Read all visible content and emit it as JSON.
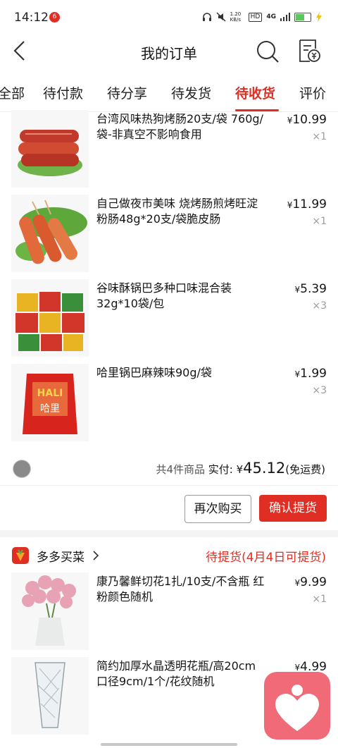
{
  "status_bar": {
    "time": "14:12",
    "notif": "6",
    "speed": "1.20 KB/s",
    "hd": "HD",
    "network": "4G"
  },
  "nav": {
    "title": "我的订单"
  },
  "tabs": [
    {
      "label": "全部"
    },
    {
      "label": "待付款"
    },
    {
      "label": "待分享"
    },
    {
      "label": "待发货"
    },
    {
      "label": "待收货",
      "active": true
    },
    {
      "label": "评价"
    }
  ],
  "order1": {
    "items": [
      {
        "name": "台湾风味热狗烤肠20支/袋 760g/袋-非真空不影响食用",
        "currency": "¥",
        "price": "10.99",
        "qty": "×1"
      },
      {
        "name": "自己做夜市美味 烧烤肠煎烤旺淀粉肠48g*20支/袋脆皮肠",
        "currency": "¥",
        "price": "11.99",
        "qty": "×1"
      },
      {
        "name": "谷味酥锅巴多种口味混合装32g*10袋/包",
        "currency": "¥",
        "price": "5.39",
        "qty": "×3"
      },
      {
        "name": "哈里锅巴麻辣味90g/袋",
        "currency": "¥",
        "price": "1.99",
        "qty": "×3"
      }
    ],
    "summary": {
      "count_text": "共4件商品",
      "paid_label": "实付:",
      "currency": "¥",
      "total": "45.12",
      "shipping": "(免运费)"
    },
    "buttons": {
      "rebuy": "再次购买",
      "confirm": "确认提货"
    }
  },
  "order2": {
    "store": {
      "name": "多多买菜",
      "status": "待提货(4月4日可提货)"
    },
    "items": [
      {
        "name": "康乃馨鲜切花1扎/10支/不含瓶 红粉颜色随机",
        "currency": "¥",
        "price": "9.99",
        "qty": "×1"
      },
      {
        "name": "简约加厚水晶透明花瓶/高20cm口径9cm/1个/花纹随机",
        "currency": "¥",
        "price": "4.99",
        "qty": ""
      }
    ]
  },
  "product_image_text": {
    "hali": "HALI",
    "hali_cn": "哈里"
  },
  "colors": {
    "accent": "#e02e24",
    "float_button": "#f06a78"
  }
}
